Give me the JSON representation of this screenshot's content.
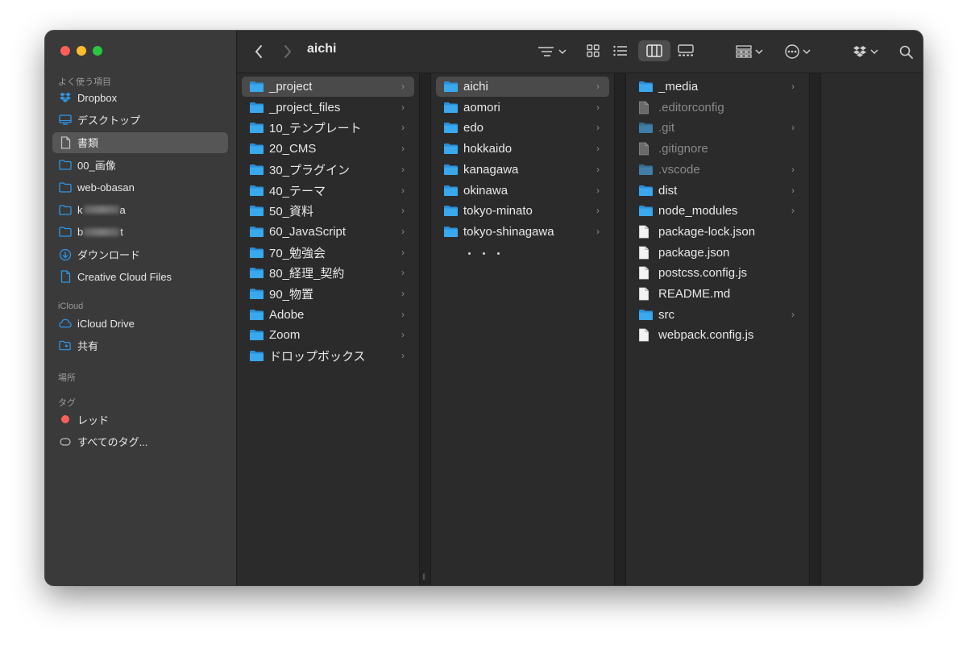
{
  "window": {
    "title": "aichi"
  },
  "sidebar": {
    "favorites_title": "よく使う項目",
    "favorites": [
      {
        "label": "Dropbox",
        "icon": "dropbox-icon"
      },
      {
        "label": "デスクトップ",
        "icon": "desktop-icon"
      },
      {
        "label": "書類",
        "icon": "document-icon",
        "selected": true
      },
      {
        "label": "00_画像",
        "icon": "folder-icon"
      },
      {
        "label": "web-obasan",
        "icon": "folder-icon"
      },
      {
        "label": "k",
        "suffix": "a",
        "icon": "folder-icon"
      },
      {
        "label": "b",
        "suffix": "t",
        "icon": "folder-icon"
      },
      {
        "label": "ダウンロード",
        "icon": "download-icon"
      },
      {
        "label": "Creative Cloud Files",
        "icon": "document-icon"
      }
    ],
    "icloud_title": "iCloud",
    "icloud": [
      {
        "label": "iCloud Drive",
        "icon": "cloud-icon"
      },
      {
        "label": "共有",
        "icon": "shared-folder-icon"
      }
    ],
    "places_title": "場所",
    "tags_title": "タグ",
    "tags": [
      {
        "label": "レッド",
        "icon": "red-tag-icon",
        "color": "#ff5f57"
      },
      {
        "label": "すべてのタグ...",
        "icon": "all-tags-icon"
      }
    ]
  },
  "columns": {
    "col1": [
      {
        "name": "_project",
        "selected": true
      },
      {
        "name": "_project_files"
      },
      {
        "name": "10_テンプレート"
      },
      {
        "name": "20_CMS"
      },
      {
        "name": "30_プラグイン"
      },
      {
        "name": "40_テーマ"
      },
      {
        "name": "50_資料"
      },
      {
        "name": "60_JavaScript"
      },
      {
        "name": "70_勉強会"
      },
      {
        "name": "80_経理_契約"
      },
      {
        "name": "90_物置"
      },
      {
        "name": "Adobe"
      },
      {
        "name": "Zoom"
      },
      {
        "name": "ドロップボックス"
      }
    ],
    "col2": [
      {
        "name": "aichi",
        "selected": true
      },
      {
        "name": "aomori"
      },
      {
        "name": "edo"
      },
      {
        "name": "hokkaido"
      },
      {
        "name": "kanagawa"
      },
      {
        "name": "okinawa"
      },
      {
        "name": "tokyo-minato"
      },
      {
        "name": "tokyo-shinagawa"
      }
    ],
    "col2_more": "・・・",
    "col3": [
      {
        "name": "_media",
        "type": "folder"
      },
      {
        "name": ".editorconfig",
        "type": "file",
        "dim": true
      },
      {
        "name": ".git",
        "type": "folder",
        "dim": true
      },
      {
        "name": ".gitignore",
        "type": "file",
        "dim": true
      },
      {
        "name": ".vscode",
        "type": "folder",
        "dim": true
      },
      {
        "name": "dist",
        "type": "folder"
      },
      {
        "name": "node_modules",
        "type": "folder"
      },
      {
        "name": "package-lock.json",
        "type": "file"
      },
      {
        "name": "package.json",
        "type": "file"
      },
      {
        "name": "postcss.config.js",
        "type": "file"
      },
      {
        "name": "README.md",
        "type": "file"
      },
      {
        "name": "src",
        "type": "folder"
      },
      {
        "name": "webpack.config.js",
        "type": "file"
      }
    ]
  },
  "colors": {
    "folder": "#3aa8ec",
    "accent": "#2d96e8",
    "close": "#ff5f57",
    "minimize": "#febc2e",
    "zoom": "#28c840"
  }
}
